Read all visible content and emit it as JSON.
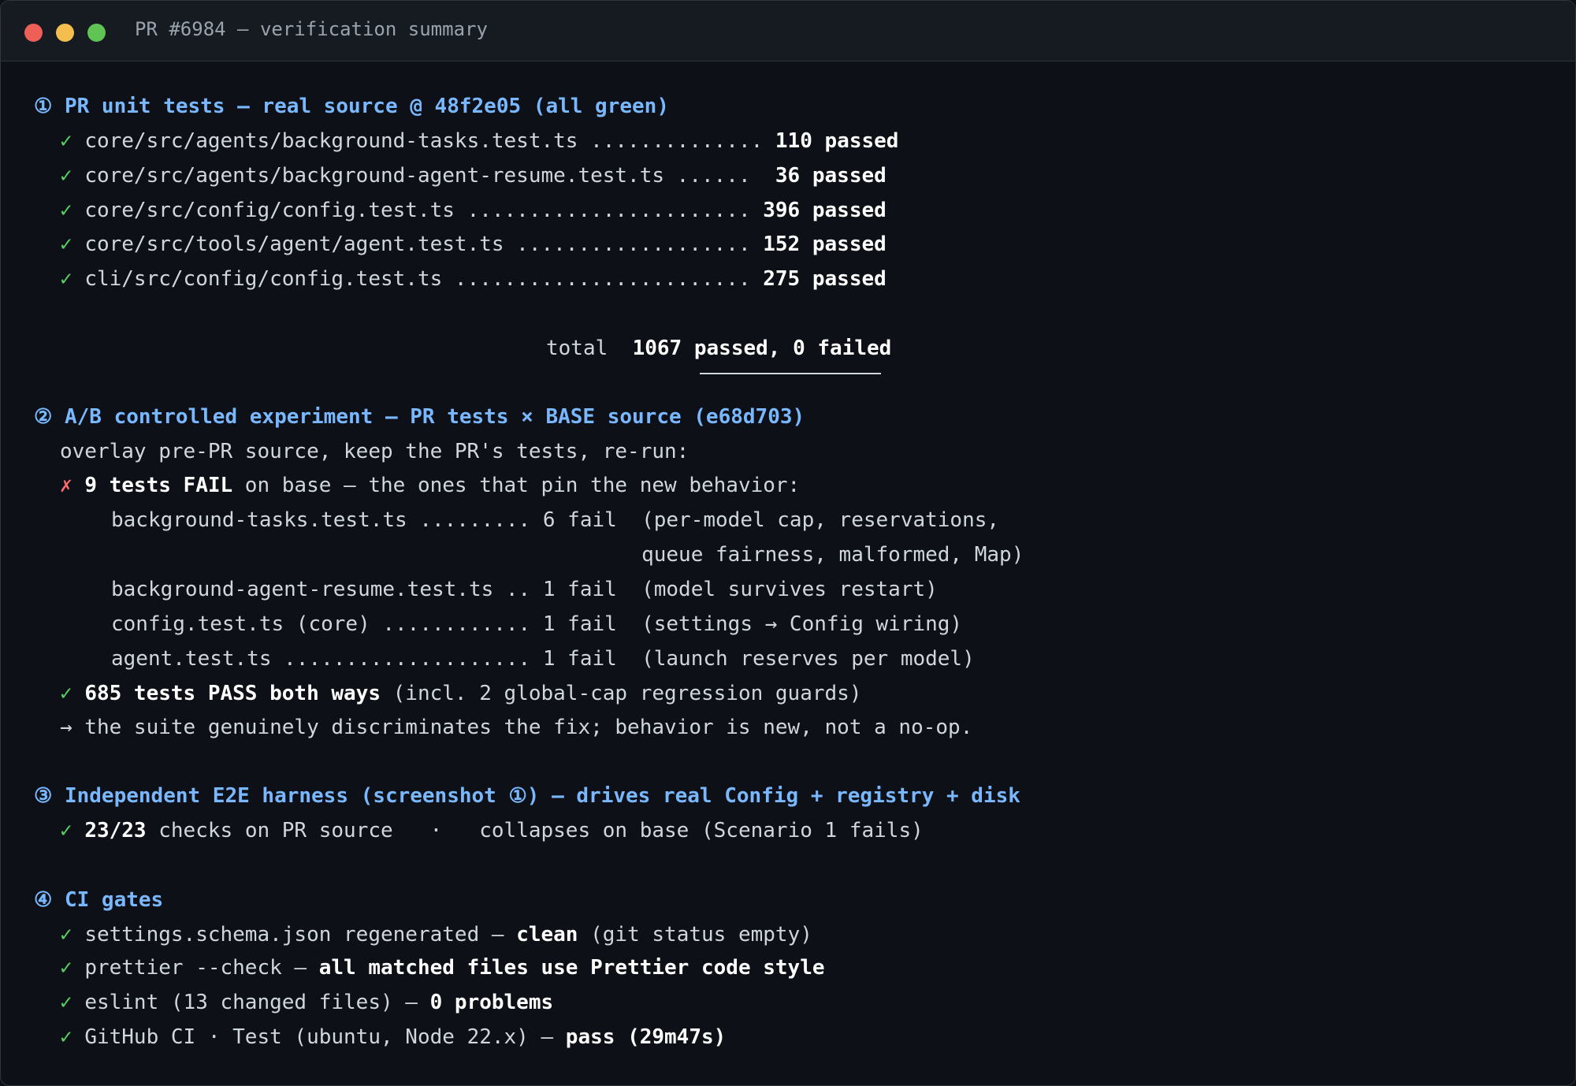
{
  "window": {
    "title": "PR #6984 — verification summary"
  },
  "sections": {
    "s1": {
      "heading": "① PR unit tests — real source @ 48f2e05 (all green)",
      "rows": [
        {
          "file": "core/src/agents/background-tasks.test.ts ..............",
          "result": "110 passed"
        },
        {
          "file": "core/src/agents/background-agent-resume.test.ts ......",
          "result": "36 passed"
        },
        {
          "file": "core/src/config/config.test.ts .......................",
          "result": "396 passed"
        },
        {
          "file": "core/src/tools/agent/agent.test.ts ...................",
          "result": "152 passed"
        },
        {
          "file": "cli/src/config/config.test.ts ........................",
          "result": "275 passed"
        }
      ],
      "total_label": "total",
      "total_value": "1067 passed, 0 failed"
    },
    "s2": {
      "heading": "② A/B controlled experiment — PR tests × BASE source (e68d703)",
      "intro": "overlay pre-PR source, keep the PR's tests, re-run:",
      "fail_mark": "✗",
      "fail_bold": "9 tests FAIL",
      "fail_rest": " on base — the ones that pin the new behavior:",
      "fail_rows": [
        "background-tasks.test.ts ......... 6 fail  (per-model cap, reservations,",
        "                                           queue fairness, malformed, Map)",
        "background-agent-resume.test.ts .. 1 fail  (model survives restart)",
        "config.test.ts (core) ............ 1 fail  (settings → Config wiring)",
        "agent.test.ts .................... 1 fail  (launch reserves per model)"
      ],
      "pass_bold": "685 tests PASS both ways",
      "pass_rest": " (incl. 2 global-cap regression guards)",
      "conclusion": "→ the suite genuinely discriminates the fix; behavior is new, not a no-op."
    },
    "s3": {
      "heading": "③ Independent E2E harness (screenshot ①) — drives real Config + registry + disk",
      "bold": "23/23",
      "rest": " checks on PR source   ·   collapses on base (Scenario 1 fails)"
    },
    "s4": {
      "heading": "④ CI gates",
      "rows": [
        {
          "pre": "settings.schema.json regenerated — ",
          "bold": "clean",
          "post": " (git status empty)"
        },
        {
          "pre": "prettier --check — ",
          "bold": "all matched files use Prettier code style",
          "post": ""
        },
        {
          "pre": "eslint (13 changed files) — ",
          "bold": "0 problems",
          "post": ""
        },
        {
          "pre": "GitHub CI · Test (ubuntu, Node 22.x) — ",
          "bold": "pass (29m47s)",
          "post": ""
        }
      ]
    }
  },
  "check_mark": "✓",
  "colors": {
    "background": "#0d1117",
    "heading": "#79b8ff",
    "check": "#56d364",
    "fail": "#ff6b6b"
  }
}
